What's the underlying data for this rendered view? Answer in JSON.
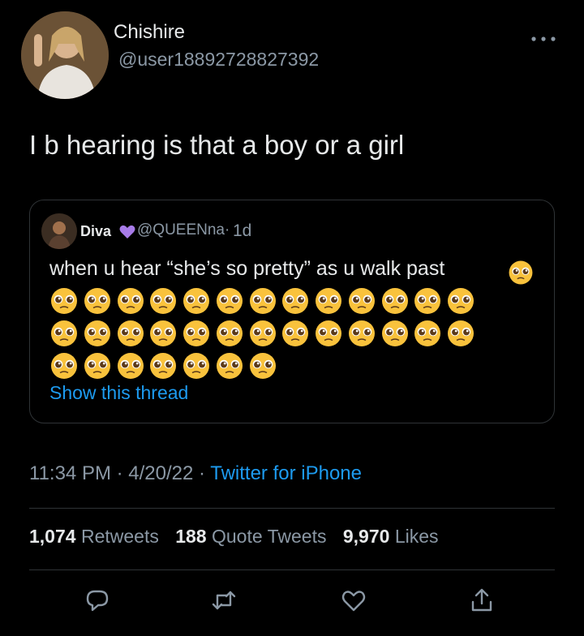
{
  "author": {
    "display_name": "Chishire",
    "handle": "@user18892728827392"
  },
  "tweet_text": "I b hearing is that a boy or a girl",
  "quoted": {
    "name": "Diva",
    "handle": "@QUEENna·",
    "time": "1d",
    "text": "when u hear “she’s so pretty” as u walk past",
    "emoji_rows": [
      13,
      13,
      7
    ],
    "show_thread": "Show this thread"
  },
  "meta": {
    "time": "11:34 PM · 4/20/22 · ",
    "source": "Twitter for iPhone"
  },
  "stats": {
    "retweets_count": "1,074",
    "retweets_label": "Retweets",
    "quotes_count": "188",
    "quotes_label": "Quote Tweets",
    "likes_count": "9,970",
    "likes_label": "Likes"
  },
  "icons": {
    "more": "more-icon",
    "reply": "reply-icon",
    "retweet": "retweet-icon",
    "like": "like-icon",
    "share": "share-icon"
  },
  "colors": {
    "background": "#000000",
    "text": "#e7e9ea",
    "secondary": "#8b98a5",
    "link": "#1d9bf0",
    "border": "#2f3336"
  }
}
